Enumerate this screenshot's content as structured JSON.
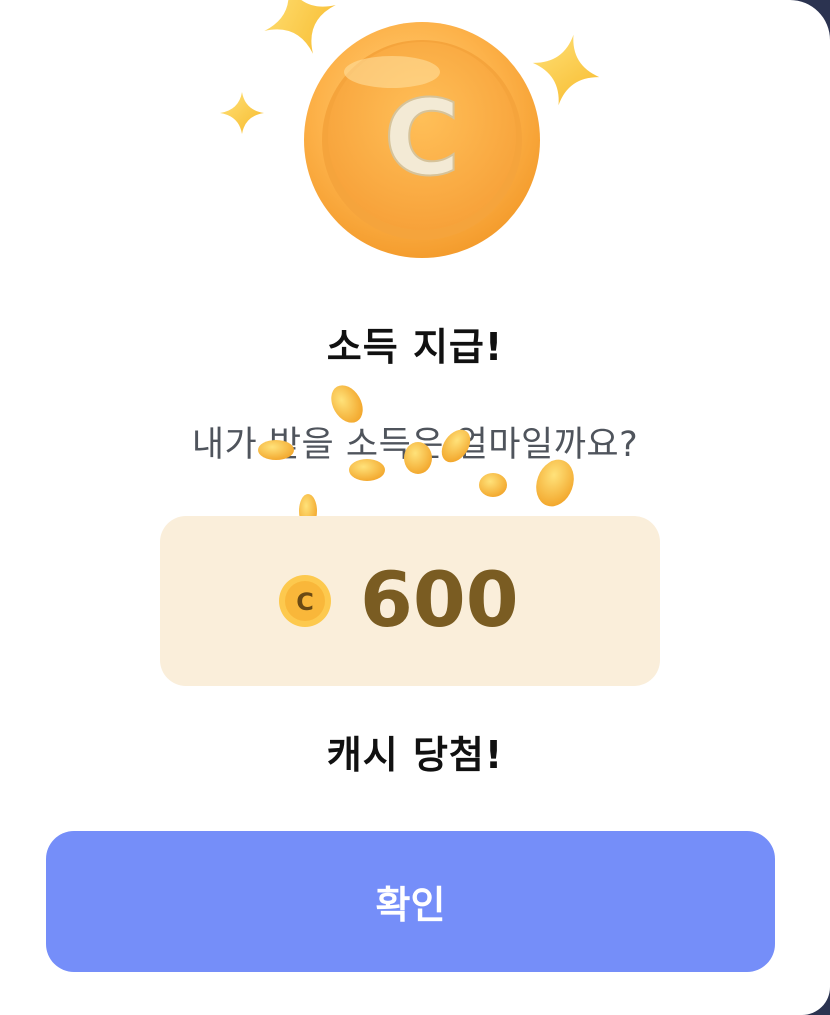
{
  "dialog": {
    "hero_icon": "coin-with-sparkles-icon",
    "hero_coin_letter": "C",
    "title": "소득 지급!",
    "subtitle": "내가 받을 소득은 얼마일까요?",
    "reward": {
      "coin_icon": "coin-icon",
      "coin_letter": "C",
      "amount": "600"
    },
    "result_text": "캐시 당첨!",
    "confirm_label": "확인"
  },
  "colors": {
    "button_bg": "#758ef9",
    "reward_box_bg": "#faeeda",
    "amount_text": "#7a5c22",
    "coin_orange": "#fdb24a"
  }
}
